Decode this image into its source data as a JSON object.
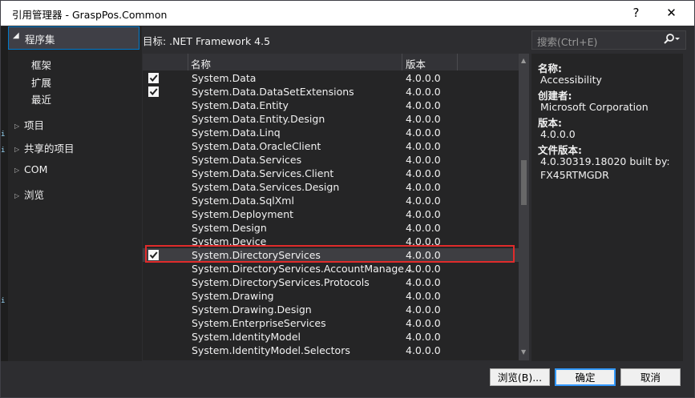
{
  "window": {
    "title": "引用管理器 - GraspPos.Common",
    "help": "?",
    "close": "✕"
  },
  "left": {
    "selected_category": "程序集",
    "subs": [
      "框架",
      "扩展",
      "最近"
    ],
    "groups": [
      "项目",
      "共享的项目",
      "COM",
      "浏览"
    ]
  },
  "target": "目标: .NET Framework 4.5",
  "columns": {
    "name": "名称",
    "version": "版本"
  },
  "rows": [
    {
      "name": "System.Data",
      "version": "4.0.0.0",
      "checked": true,
      "selected": false
    },
    {
      "name": "System.Data.DataSetExtensions",
      "version": "4.0.0.0",
      "checked": true,
      "selected": false
    },
    {
      "name": "System.Data.Entity",
      "version": "4.0.0.0",
      "checked": false,
      "selected": false
    },
    {
      "name": "System.Data.Entity.Design",
      "version": "4.0.0.0",
      "checked": false,
      "selected": false
    },
    {
      "name": "System.Data.Linq",
      "version": "4.0.0.0",
      "checked": false,
      "selected": false
    },
    {
      "name": "System.Data.OracleClient",
      "version": "4.0.0.0",
      "checked": false,
      "selected": false
    },
    {
      "name": "System.Data.Services",
      "version": "4.0.0.0",
      "checked": false,
      "selected": false
    },
    {
      "name": "System.Data.Services.Client",
      "version": "4.0.0.0",
      "checked": false,
      "selected": false
    },
    {
      "name": "System.Data.Services.Design",
      "version": "4.0.0.0",
      "checked": false,
      "selected": false
    },
    {
      "name": "System.Data.SqlXml",
      "version": "4.0.0.0",
      "checked": false,
      "selected": false
    },
    {
      "name": "System.Deployment",
      "version": "4.0.0.0",
      "checked": false,
      "selected": false
    },
    {
      "name": "System.Design",
      "version": "4.0.0.0",
      "checked": false,
      "selected": false
    },
    {
      "name": "System.Device",
      "version": "4.0.0.0",
      "checked": false,
      "selected": false
    },
    {
      "name": "System.DirectoryServices",
      "version": "4.0.0.0",
      "checked": true,
      "selected": true
    },
    {
      "name": "System.DirectoryServices.AccountManage...",
      "version": "4.0.0.0",
      "checked": false,
      "selected": false
    },
    {
      "name": "System.DirectoryServices.Protocols",
      "version": "4.0.0.0",
      "checked": false,
      "selected": false
    },
    {
      "name": "System.Drawing",
      "version": "4.0.0.0",
      "checked": false,
      "selected": false
    },
    {
      "name": "System.Drawing.Design",
      "version": "4.0.0.0",
      "checked": false,
      "selected": false
    },
    {
      "name": "System.EnterpriseServices",
      "version": "4.0.0.0",
      "checked": false,
      "selected": false
    },
    {
      "name": "System.IdentityModel",
      "version": "4.0.0.0",
      "checked": false,
      "selected": false
    },
    {
      "name": "System.IdentityModel.Selectors",
      "version": "4.0.0.0",
      "checked": false,
      "selected": false
    }
  ],
  "search": {
    "placeholder": "搜索(Ctrl+E)"
  },
  "details": [
    {
      "key": "名称:",
      "lines": [
        "Accessibility"
      ]
    },
    {
      "key": "创建者:",
      "lines": [
        "Microsoft Corporation"
      ]
    },
    {
      "key": "版本:",
      "lines": [
        "4.0.0.0"
      ]
    },
    {
      "key": "文件版本:",
      "lines": [
        "4.0.30319.18020 built by:",
        "FX45RTMGDR"
      ]
    }
  ],
  "buttons": {
    "browse": "浏览(B)...",
    "ok": "确定",
    "cancel": "取消"
  },
  "colors": {
    "accent": "#007acc",
    "highlight_box": "#e02b2b",
    "background": "#2d2d30"
  },
  "icons": {
    "expanded": "triangle-down-icon",
    "collapsed": "triangle-right-icon",
    "search": "search-icon",
    "check": "check-icon"
  }
}
